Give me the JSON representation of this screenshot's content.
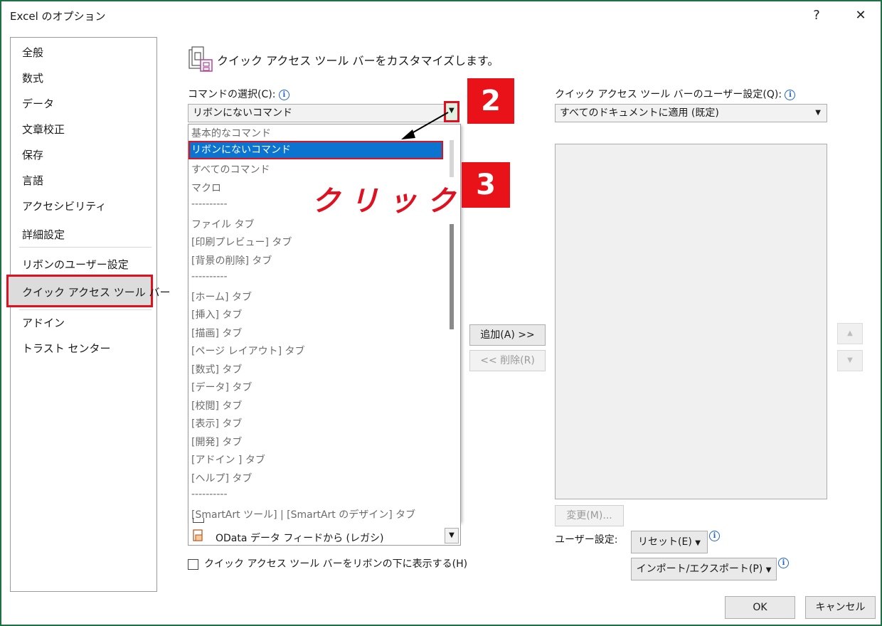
{
  "window": {
    "title": "Excel のオプション",
    "help_label": "?",
    "close_label": "✕"
  },
  "sidebar": {
    "items": [
      {
        "label": "全般"
      },
      {
        "label": "数式"
      },
      {
        "label": "データ"
      },
      {
        "label": "文章校正"
      },
      {
        "label": "保存"
      },
      {
        "label": "言語"
      },
      {
        "label": "アクセシビリティ"
      },
      {
        "label": "詳細設定"
      },
      {
        "label": "リボンのユーザー設定"
      },
      {
        "label": "クイック アクセス ツール バー"
      },
      {
        "label": "アドイン"
      },
      {
        "label": "トラスト センター"
      }
    ],
    "selected": "クイック アクセス ツール バー"
  },
  "main": {
    "heading": "クイック アクセス ツール バーをカスタマイズします。",
    "choose_commands_label": "コマンドの選択(C):",
    "choose_commands_value": "リボンにないコマンド",
    "dropdown_options": [
      "基本的なコマンド",
      "リボンにないコマンド",
      "すべてのコマンド",
      "マクロ",
      "----------",
      "ファイル タブ",
      "[印刷プレビュー] タブ",
      "[背景の削除] タブ",
      "----------",
      "[ホーム] タブ",
      "[挿入] タブ",
      "[描画] タブ",
      "[ページ レイアウト] タブ",
      "[数式] タブ",
      "[データ] タブ",
      "[校閲] タブ",
      "[表示] タブ",
      "[開発] タブ",
      "[アドイン ] タブ",
      "[ヘルプ] タブ",
      "----------",
      "[SmartArt ツール] | [SmartArt のデザイン] タブ"
    ],
    "dropdown_selected": "リボンにないコマンド",
    "list_partial_item": "OData データ フィードから (レガシ)",
    "show_below_ribbon_label": "クイック アクセス ツール バーをリボンの下に表示する(H)",
    "add_button": "追加(A) >>",
    "remove_button": "<< 削除(R)"
  },
  "right": {
    "customize_label": "クイック アクセス ツール バーのユーザー設定(Q):",
    "customize_value": "すべてのドキュメントに適用 (既定)",
    "modify_button": "変更(M)...",
    "customizations_label": "ユーザー設定:",
    "reset_button": "リセット(E)",
    "import_export_button": "インポート/エクスポート(P)",
    "up_icon": "▲",
    "down_icon": "▼"
  },
  "footer": {
    "ok": "OK",
    "cancel": "キャンセル"
  },
  "annotations": {
    "step2": "2",
    "step3": "3",
    "click_text": "クリック",
    "accent_red": "#e81218"
  },
  "colors": {
    "window_border": "#1e7145",
    "selection_blue": "#0a74d0",
    "info_blue": "#1f63c6"
  }
}
